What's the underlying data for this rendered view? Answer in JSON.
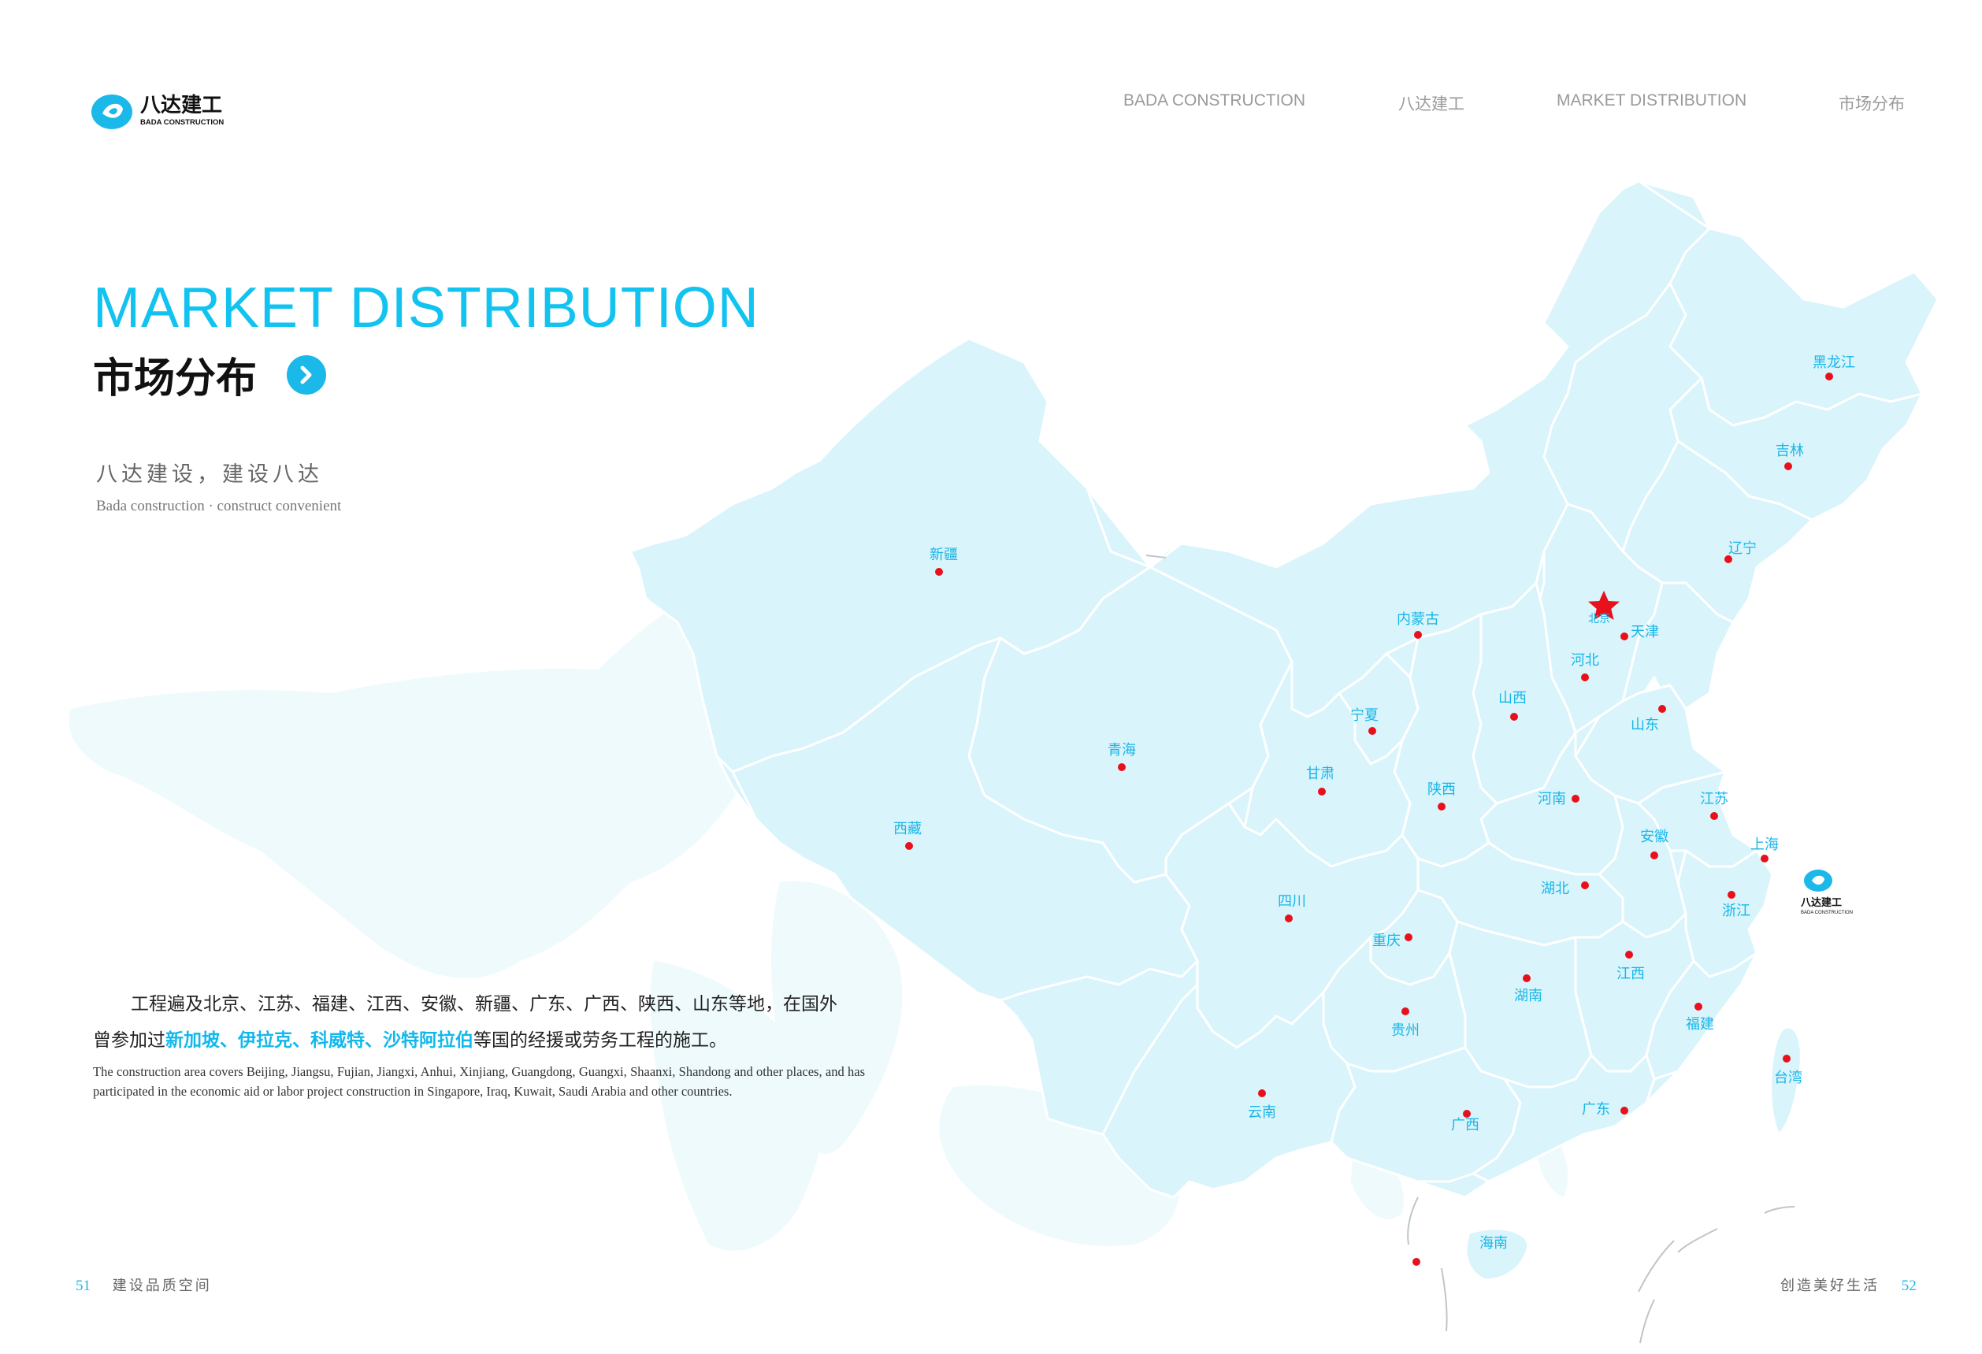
{
  "header": {
    "brand_cn": "八达建工",
    "brand_en": "BADA CONSTRUCTION",
    "nav": [
      "BADA CONSTRUCTION",
      "八达建工",
      "MARKET DISTRIBUTION",
      "市场分布"
    ]
  },
  "hero": {
    "title_en": "MARKET DISTRIBUTION",
    "title_cn": "市场分布",
    "slogan_cn": "八达建设，建设八达",
    "slogan_en": "Bada construction  ·  construct convenient"
  },
  "body": {
    "para1_a": "工程遍及北京、江苏、福建、江西、安徽、新疆、广东、广西、陕西、山东等地，在国外",
    "para1_b": "曾参加过",
    "para1_highlight": "新加坡、伊拉克、科威特、沙特阿拉伯",
    "para1_c": "等国的经援或劳务工程的施工。",
    "para_en": "The construction area covers Beijing, Jiangsu, Fujian, Jiangxi, Anhui, Xinjiang, Guangdong, Guangxi, Shaanxi, Shandong and other places, and has participated in the economic aid or labor project construction in Singapore, Iraq, Kuwait, Saudi Arabia and other countries."
  },
  "map": {
    "capital": "北京",
    "marker_color": "#e8101a",
    "land_color": "#d9f4fb",
    "world_color": "#eefafc",
    "label_color": "#17b6e9",
    "provinces": [
      {
        "name": "黑龙江"
      },
      {
        "name": "吉林"
      },
      {
        "name": "辽宁"
      },
      {
        "name": "新疆"
      },
      {
        "name": "内蒙古"
      },
      {
        "name": "天津"
      },
      {
        "name": "河北"
      },
      {
        "name": "山西"
      },
      {
        "name": "宁夏"
      },
      {
        "name": "山东"
      },
      {
        "name": "青海"
      },
      {
        "name": "甘肃"
      },
      {
        "name": "陕西"
      },
      {
        "name": "河南"
      },
      {
        "name": "江苏"
      },
      {
        "name": "西藏"
      },
      {
        "name": "安徽"
      },
      {
        "name": "上海"
      },
      {
        "name": "四川"
      },
      {
        "name": "湖北"
      },
      {
        "name": "浙江"
      },
      {
        "name": "重庆"
      },
      {
        "name": "江西"
      },
      {
        "name": "湖南"
      },
      {
        "name": "福建"
      },
      {
        "name": "贵州"
      },
      {
        "name": "台湾"
      },
      {
        "name": "云南"
      },
      {
        "name": "广西"
      },
      {
        "name": "广东"
      },
      {
        "name": "海南"
      }
    ]
  },
  "footer": {
    "left_page": "51",
    "left_text": "建设品质空间",
    "right_text": "创造美好生活",
    "right_page": "52"
  }
}
